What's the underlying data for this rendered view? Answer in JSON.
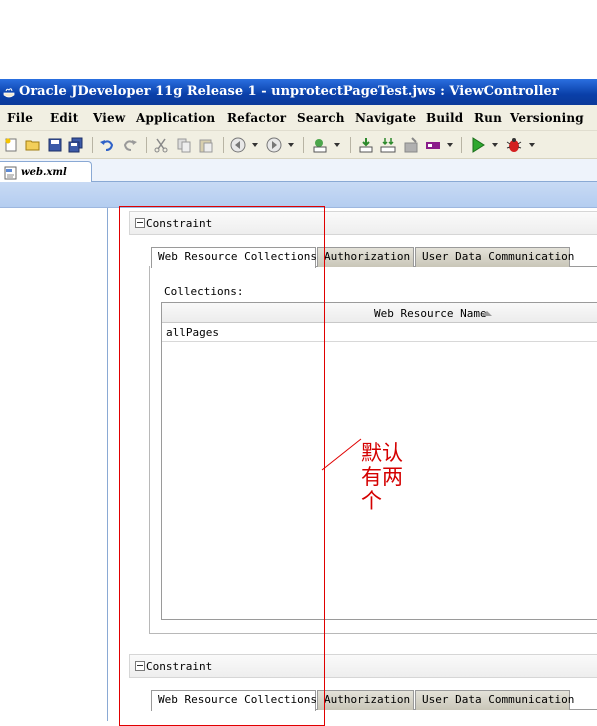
{
  "window": {
    "title": "Oracle JDeveloper 11g Release 1 - unprotectPageTest.jws : ViewController"
  },
  "menu": [
    {
      "label": "File"
    },
    {
      "label": "Edit"
    },
    {
      "label": "View"
    },
    {
      "label": "Application"
    },
    {
      "label": "Refactor"
    },
    {
      "label": "Search"
    },
    {
      "label": "Navigate"
    },
    {
      "label": "Build"
    },
    {
      "label": "Run"
    },
    {
      "label": "Versioning"
    }
  ],
  "toolbar": {
    "icons": [
      "new-icon",
      "open-icon",
      "save-icon",
      "save-all-icon",
      "undo-icon",
      "redo-icon",
      "cut-icon",
      "copy-icon",
      "paste-icon",
      "back-icon",
      "forward-icon",
      "sql-worksheet-icon",
      "deploy-icon",
      "make-icon",
      "rebuild-icon",
      "clean-icon",
      "run-icon",
      "debug-icon"
    ]
  },
  "editor_tab": {
    "label": "web.xml",
    "icon": "xml-file-icon"
  },
  "constraints": [
    {
      "title": "Constraint",
      "tabs": [
        "Web Resource Collections",
        "Authorization",
        "User Data Communication"
      ],
      "active_tab": "Web Resource Collections",
      "collections_label": "Collections:",
      "table": {
        "columns": [
          "Web Resource Name"
        ],
        "sort": "ascending",
        "rows": [
          [
            "allPages"
          ]
        ]
      }
    },
    {
      "title": "Constraint",
      "tabs": [
        "Web Resource Collections",
        "Authorization",
        "User Data Communication"
      ],
      "active_tab": "Web Resource Collections"
    }
  ],
  "annotation": {
    "text": "默认有两个",
    "color": "#d40000"
  },
  "colors": {
    "titlebar": "#0a3fa8",
    "chrome": "#f1efe2",
    "ribbon": "#c8daf4",
    "annotation_red": "#e00000"
  }
}
